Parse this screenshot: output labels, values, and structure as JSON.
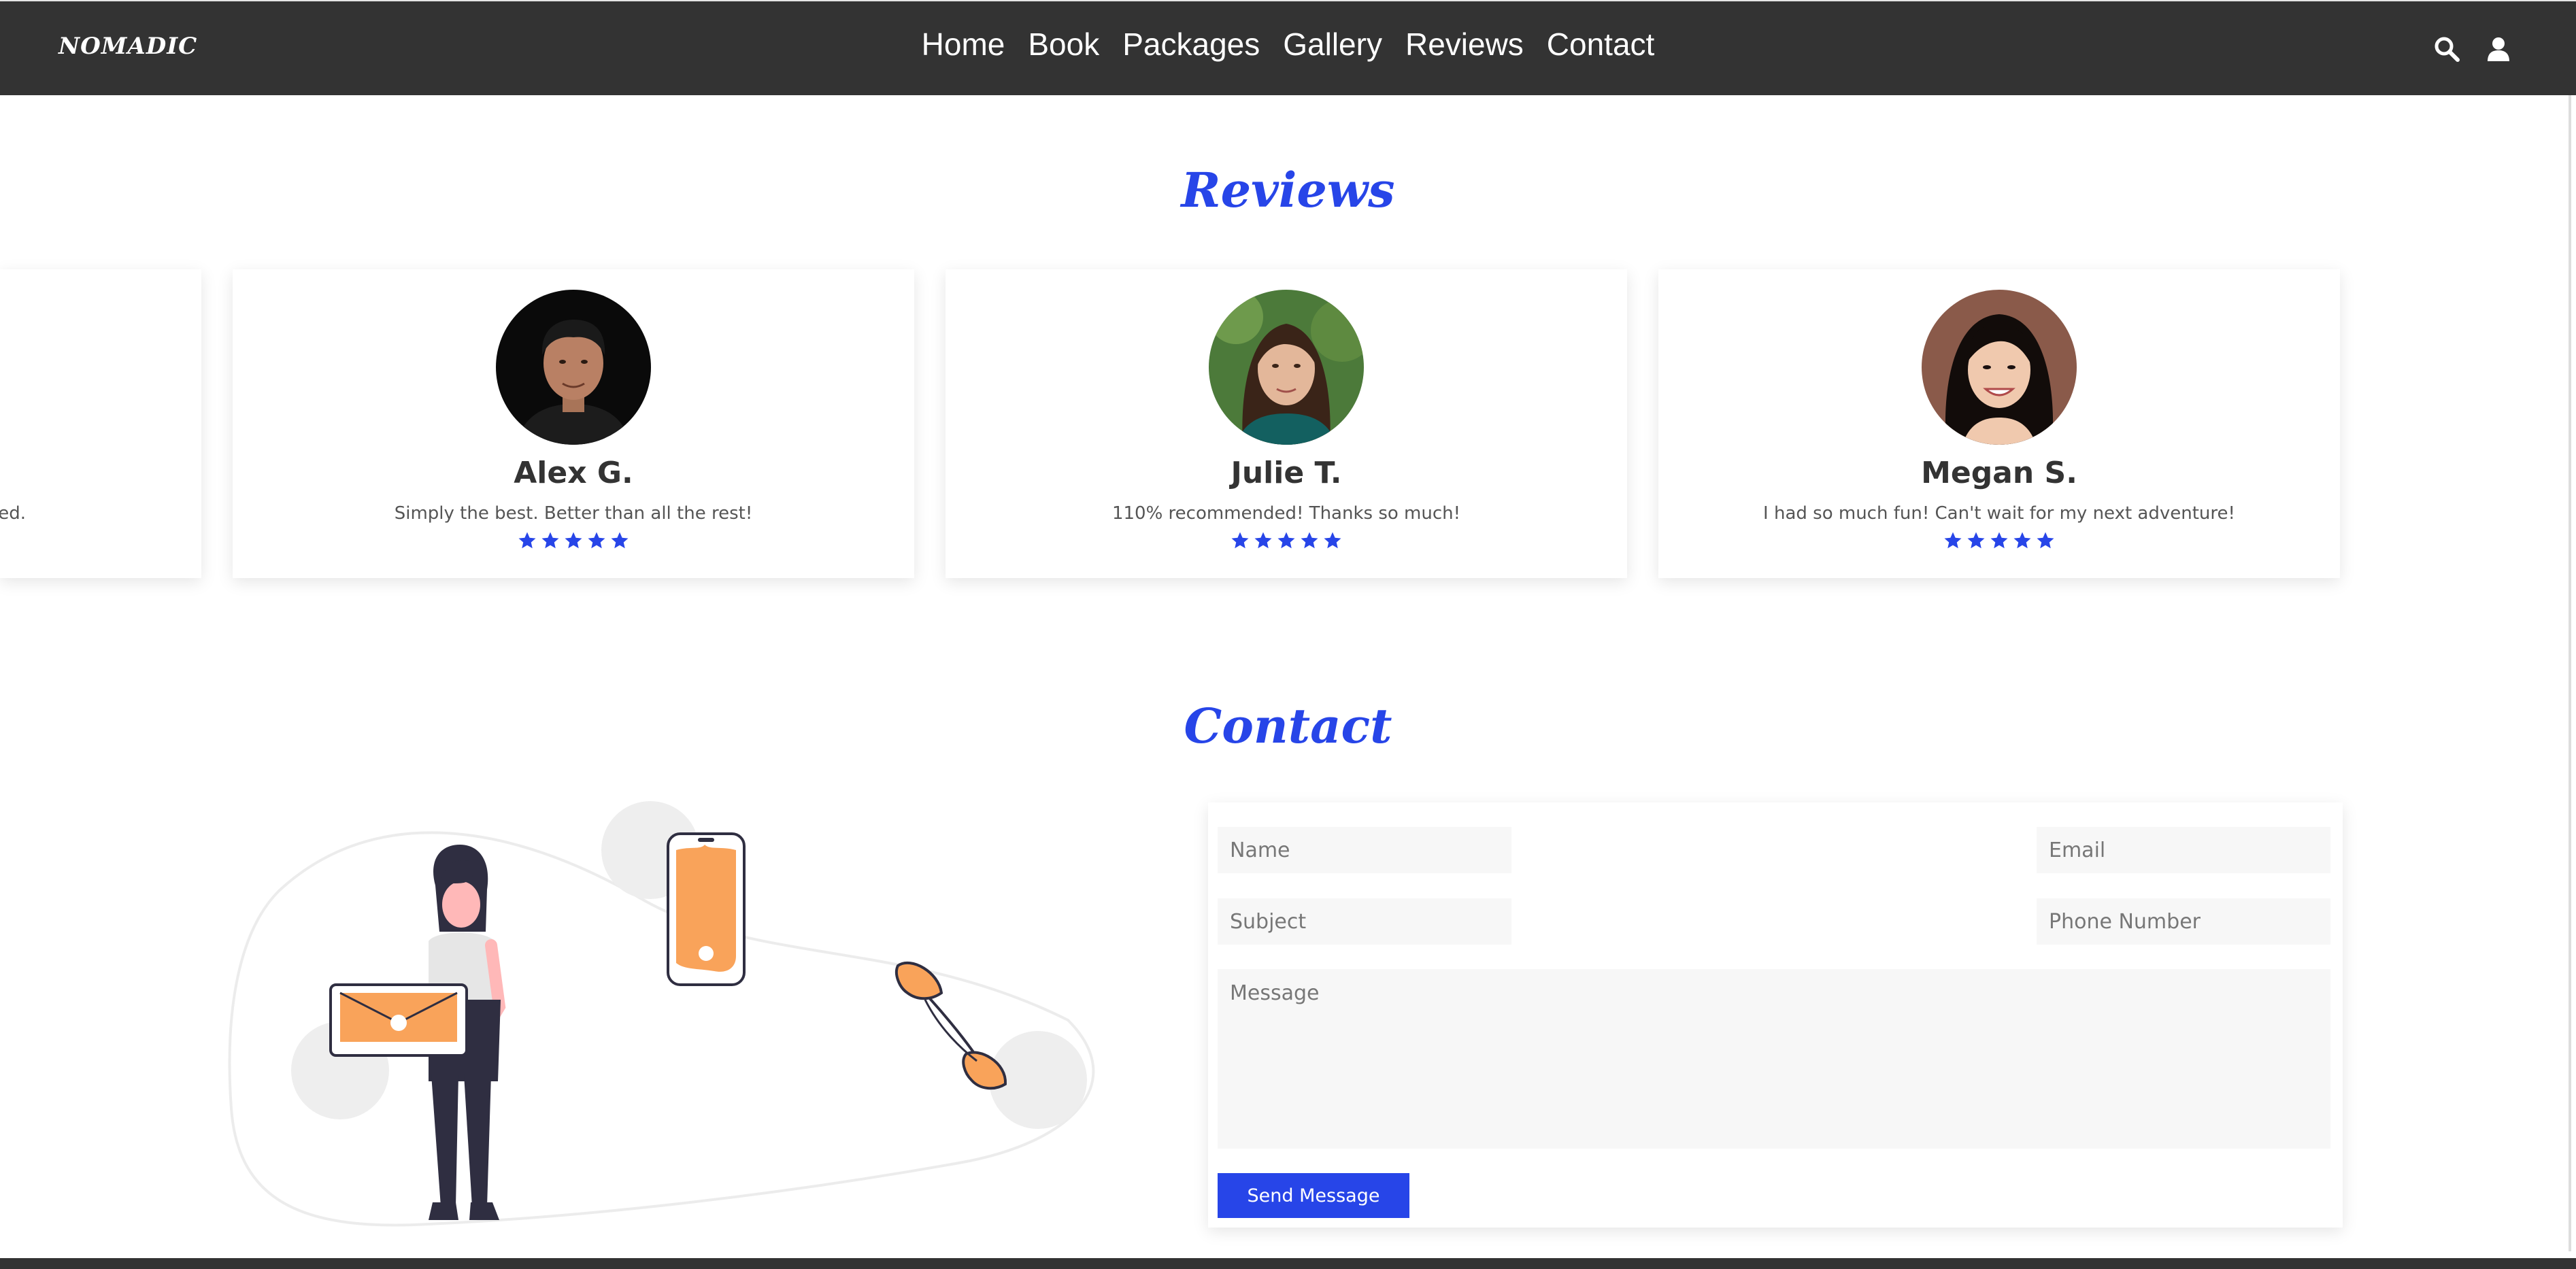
{
  "nav": {
    "logo": "NOMADIC",
    "links": [
      "Home",
      "Book",
      "Packages",
      "Gallery",
      "Reviews",
      "Contact"
    ],
    "icons": [
      "search-icon",
      "user-icon"
    ]
  },
  "reviews": {
    "title": "Reviews",
    "partial_text": "ed.",
    "cards": [
      {
        "name": "Alex G.",
        "text": "Simply the best. Better than all the rest!",
        "rating": 5
      },
      {
        "name": "Julie T.",
        "text": "110% recommended! Thanks so much!",
        "rating": 5
      },
      {
        "name": "Megan S.",
        "text": "I had so much fun! Can't wait for my next adventure!",
        "rating": 5
      }
    ]
  },
  "contact": {
    "title": "Contact",
    "fields": {
      "name": "Name",
      "email": "Email",
      "subject": "Subject",
      "phone": "Phone Number",
      "message": "Message"
    },
    "button": "Send Message"
  },
  "colors": {
    "accent": "#2745e8",
    "nav_bg": "#333333",
    "illustration_orange": "#f9a35a"
  }
}
